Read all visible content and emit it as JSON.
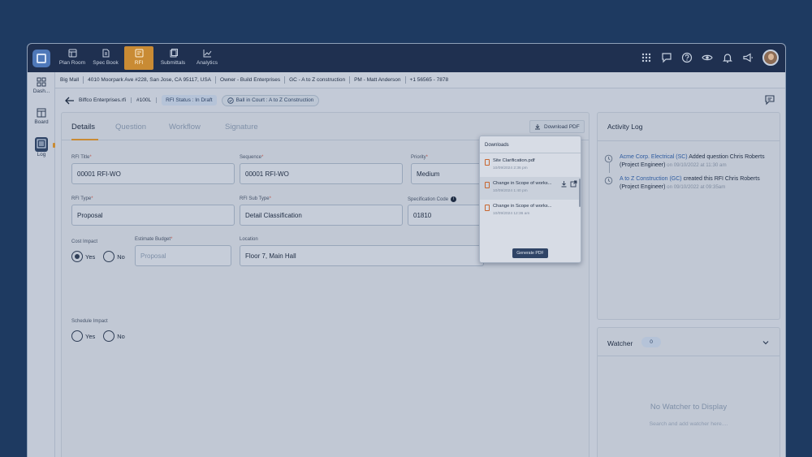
{
  "topnav": {
    "items": [
      {
        "label": "Plan Room",
        "icon": "plan-room-icon"
      },
      {
        "label": "Spec Book",
        "icon": "spec-book-icon"
      },
      {
        "label": "RFI",
        "icon": "rfi-icon",
        "active": true
      },
      {
        "label": "Submittals",
        "icon": "submittals-icon"
      },
      {
        "label": "Analytics",
        "icon": "analytics-icon"
      }
    ],
    "right_icons": [
      "apps-grid-icon",
      "chat-icon",
      "help-icon",
      "eye-icon",
      "bell-icon",
      "megaphone-icon",
      "user-avatar"
    ]
  },
  "sidebar": {
    "items": [
      {
        "label": "Dash...",
        "icon": "dashboard-icon"
      },
      {
        "label": "Board",
        "icon": "board-icon"
      },
      {
        "label": "Log",
        "icon": "log-icon",
        "active": true
      }
    ]
  },
  "project": {
    "name": "Big Mall",
    "address": "4010 Moorpark Ave #228, San Jose, CA 95117, USA",
    "owner": "Owner - Build Enterprises",
    "gc": "GC - A to Z construction",
    "pm": "PM - Matt Anderson",
    "phone": "+1 56565 - 7878"
  },
  "subheader": {
    "file": "Biffco Enterprises.rfi",
    "number": "#100L",
    "status": "RFI Status : In Draft",
    "ball_in_court": "Ball in Court : A to Z Construction"
  },
  "tabs": [
    {
      "label": "Details",
      "active": true
    },
    {
      "label": "Question"
    },
    {
      "label": "Workflow"
    },
    {
      "label": "Signature"
    }
  ],
  "download_pdf_label": "Download PDF",
  "form": {
    "rfi_title": {
      "label": "RFI Title",
      "value": "00001 RFI-WO"
    },
    "sequence": {
      "label": "Sequence",
      "value": "00001 RFI-WO"
    },
    "priority": {
      "label": "Priority",
      "value": "Medium"
    },
    "rfi_type": {
      "label": "RFI Type",
      "value": "Proposal"
    },
    "rfi_sub_type": {
      "label": "RFI Sub Type",
      "value": "Detail Classification"
    },
    "spec_code": {
      "label": "Specification Code",
      "value": "01810"
    },
    "cost_impact": {
      "label": "Cost Impact",
      "yes": "Yes",
      "no": "No",
      "selected": "Yes"
    },
    "estimate_budget": {
      "label": "Estimate Budget",
      "placeholder": "Proposal"
    },
    "location": {
      "label": "Location",
      "value": "Floor 7, Main Hall"
    },
    "schedule_impact": {
      "label": "Schedule Impact",
      "yes": "Yes",
      "no": "No"
    }
  },
  "downloads": {
    "title": "Downloads",
    "items": [
      {
        "name": "Site Clarification.pdf",
        "date": "10/09/2024 2:36 pm"
      },
      {
        "name": "Change in Scope of works...",
        "date": "10/09/2024 1:40 pm"
      },
      {
        "name": "Change in Scope of works...",
        "date": "10/09/2024 12:36 am"
      }
    ],
    "generate_label": "Generate PDF"
  },
  "activity_log": {
    "title": "Activity Log",
    "entries": [
      {
        "actor": "Acme Corp. Electrical (SC)",
        "action": " Added question Chris Roberts (Project Engineer)",
        "date": " on 09/10/2022 at 11:30 am"
      },
      {
        "actor": "A to Z Construction (GC)",
        "action": " created this RFI Chris Roberts (Project Engineer)",
        "date": " on 09/10/2022 at 09:35am"
      }
    ]
  },
  "watcher": {
    "title": "Watcher",
    "count": "0",
    "empty_title": "No Watcher to Display",
    "empty_hint": "Search and add watcher here...."
  },
  "colors": {
    "backdrop": "#1e3a61",
    "topbar": "#1f3050",
    "accent": "#c98b34",
    "link": "#2d5ba0"
  }
}
